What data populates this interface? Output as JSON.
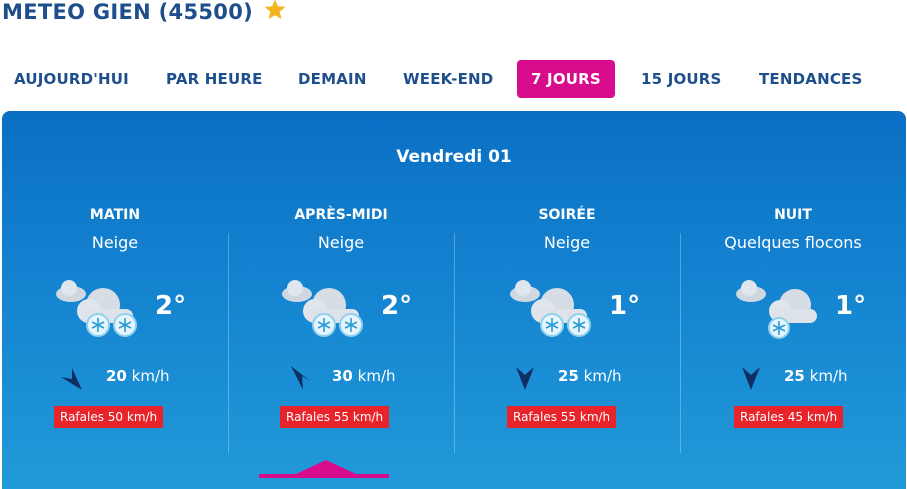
{
  "page": {
    "title": "METEO GIEN (45500)"
  },
  "tabs": [
    {
      "label": "AUJOURD'HUI",
      "active": false
    },
    {
      "label": "PAR HEURE",
      "active": false
    },
    {
      "label": "DEMAIN",
      "active": false
    },
    {
      "label": "WEEK-END",
      "active": false
    },
    {
      "label": "7 JOURS",
      "active": true
    },
    {
      "label": "15 JOURS",
      "active": false
    },
    {
      "label": "TENDANCES",
      "active": false
    }
  ],
  "forecast": {
    "day": "Vendredi 01",
    "periods": [
      {
        "name": "MATIN",
        "condition": "Neige",
        "icon": "snow-heavy-icon",
        "temperature": "2°",
        "wind_speed": "20",
        "wind_unit": "km/h",
        "wind_direction_icon": "wind-arrow-icon",
        "gust": "Rafales 50 km/h"
      },
      {
        "name": "APRÈS-MIDI",
        "condition": "Neige",
        "icon": "snow-heavy-icon",
        "temperature": "2°",
        "wind_speed": "30",
        "wind_unit": "km/h",
        "wind_direction_icon": "wind-arrow-icon",
        "gust": "Rafales 55 km/h"
      },
      {
        "name": "SOIRÉE",
        "condition": "Neige",
        "icon": "snow-heavy-icon",
        "temperature": "1°",
        "wind_speed": "25",
        "wind_unit": "km/h",
        "wind_direction_icon": "wind-arrow-icon",
        "gust": "Rafales 55 km/h"
      },
      {
        "name": "NUIT",
        "condition": "Quelques flocons",
        "icon": "snow-light-icon",
        "temperature": "1°",
        "wind_speed": "25",
        "wind_unit": "km/h",
        "wind_direction_icon": "wind-arrow-icon",
        "gust": "Rafales 45 km/h"
      }
    ]
  },
  "colors": {
    "accent": "#d80b8c",
    "title": "#1e4f8c",
    "panel_top": "#0a6fc4",
    "panel_bottom": "#219ad8",
    "gust": "#e8232a",
    "star": "#f2b51c"
  }
}
